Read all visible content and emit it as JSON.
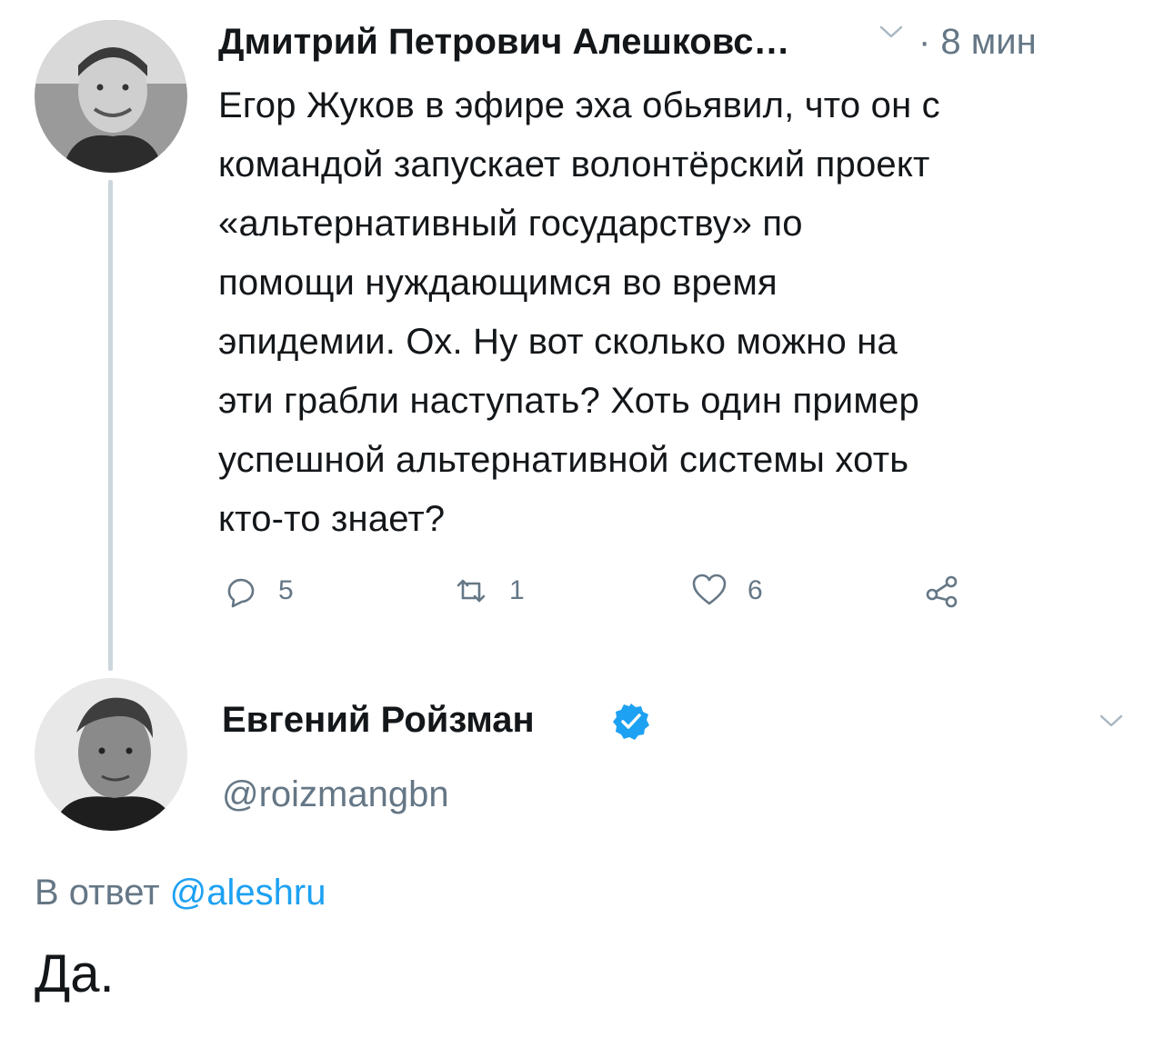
{
  "tweet1": {
    "author_name": "Дмитрий Петрович Алешковс…",
    "time": "· 8 мин",
    "text": "Егор Жуков в эфире эха обьявил, что он с\nкомандой запускает волонтёрский проект\n«альтернативный государству» по\nпомощи нуждающимся во время\nэпидемии. Ох. Ну вот сколько можно на\nэти грабли наступать? Хоть один пример\nуспешной альтернативной системы хоть\nкто-то знает?",
    "replies": "5",
    "retweets": "1",
    "likes": "6",
    "icons": {
      "reply": "reply-icon",
      "retweet": "retweet-icon",
      "like": "heart-icon",
      "share": "share-icon",
      "menu": "chevron-down-icon"
    }
  },
  "tweet2": {
    "author_name": "Евгений Ройзман",
    "handle": "@roizmangbn",
    "reply_prefix": "В ответ",
    "reply_to": "@aleshru",
    "text": "Да.",
    "icons": {
      "verified": "verified-badge-icon",
      "menu": "chevron-down-icon"
    }
  },
  "colors": {
    "text": "#14171a",
    "secondary": "#657786",
    "link": "#1da1f2",
    "thread_line": "#ccd6dd"
  }
}
